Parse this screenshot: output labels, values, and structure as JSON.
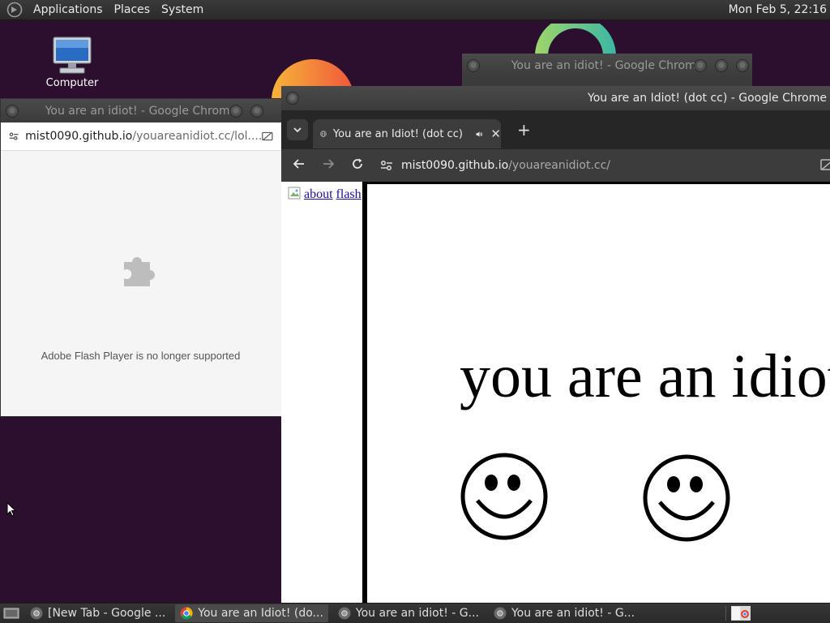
{
  "top_panel": {
    "menus": [
      "Applications",
      "Places",
      "System"
    ],
    "clock": "Mon Feb  5, 22:16"
  },
  "desktop": {
    "computer_label": "Computer"
  },
  "window_back": {
    "title": "You are an idiot! - Google Chrome"
  },
  "window_left": {
    "title": "You are an idiot! - Google Chrome",
    "url_host": "mist0090.github.io",
    "url_path": "/youareanidiot.cc/lol....",
    "plugin_message": "Adobe Flash Player is no longer supported"
  },
  "window_main": {
    "title": "You are an Idiot! (dot cc) - Google Chrome",
    "tab_title": "You are an Idiot! (dot cc)",
    "new_tab": "+",
    "url_host": "mist0090.github.io",
    "url_path": "/youareanidiot.cc/",
    "page": {
      "link_about": "about",
      "link_flash": "flash",
      "headline": "you are an idiot"
    }
  },
  "taskbar": {
    "tasks": [
      {
        "label": "[New Tab - Google ...",
        "active": false
      },
      {
        "label": "You are an Idiot! (do...",
        "active": true
      },
      {
        "label": "You are an idiot! - G...",
        "active": false
      },
      {
        "label": "You are an idiot! - G...",
        "active": false
      }
    ]
  },
  "icons": {
    "panel_logo": "gnome-foot-icon",
    "computer": "computer-icon",
    "puzzle": "plugin-puzzle-icon",
    "chrome": "chrome-icon",
    "globe": "globe-icon",
    "audio": "speaker-icon"
  },
  "colors": {
    "desktop_bg": "#2c0f2e",
    "panel_bg": "#2e2e2e",
    "link": "#1a0dab"
  }
}
